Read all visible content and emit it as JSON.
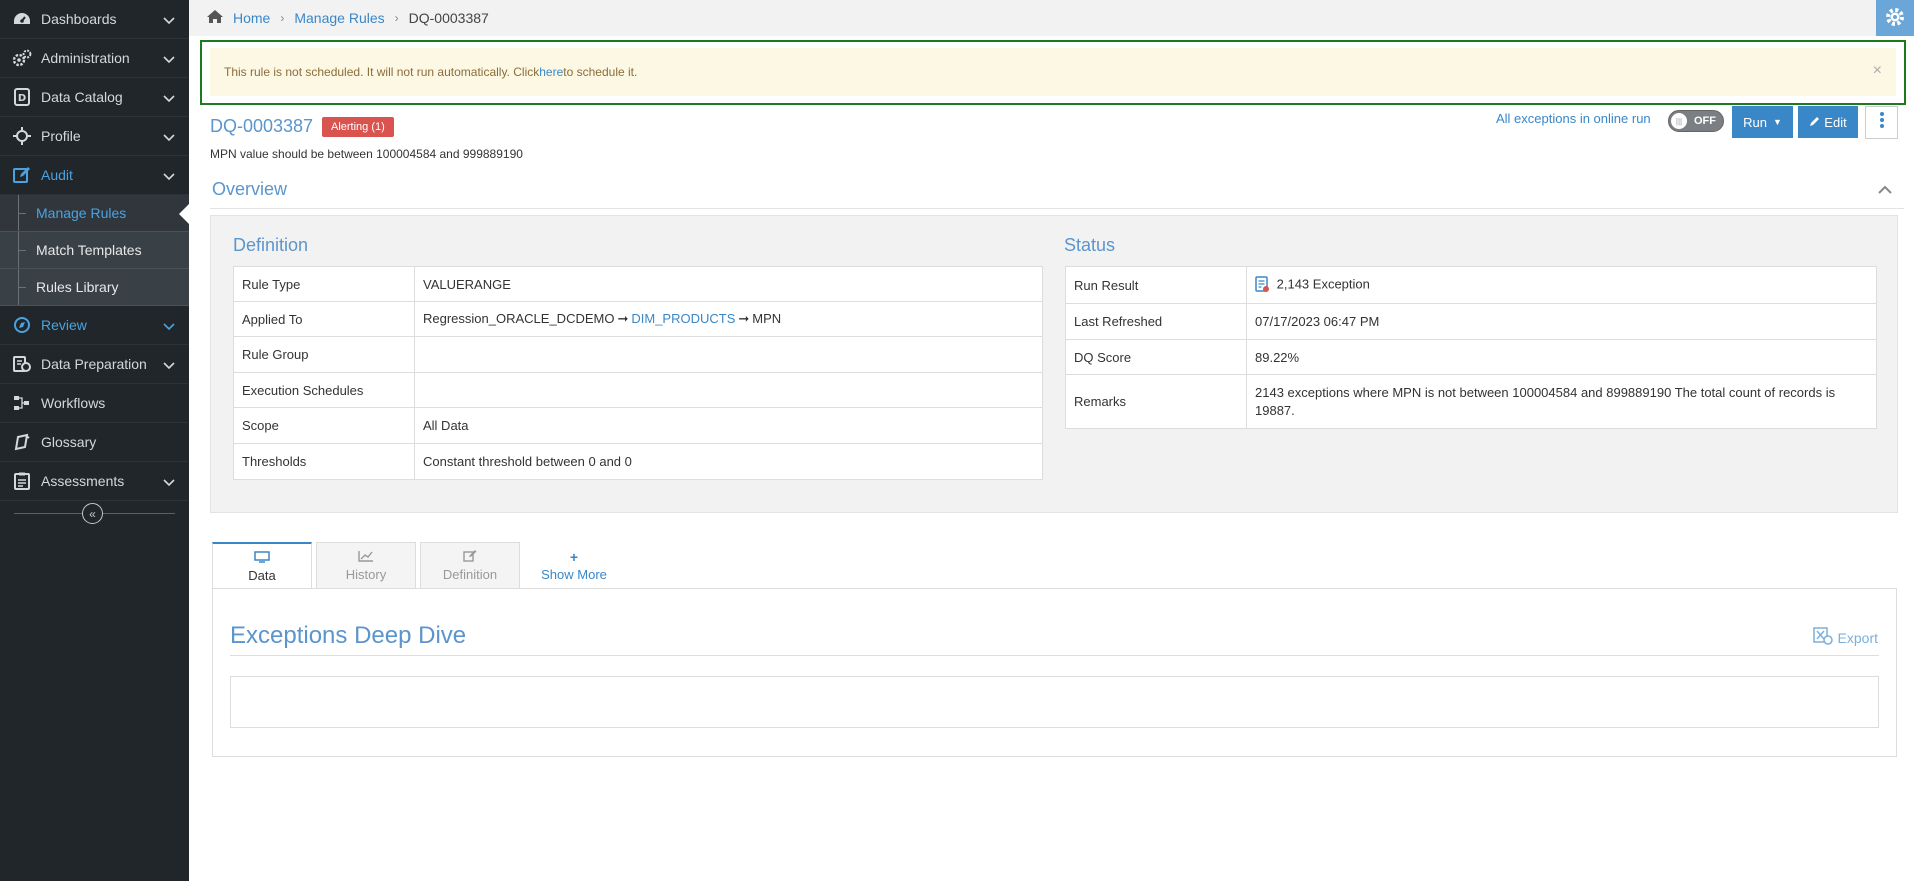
{
  "sidebar": {
    "items": [
      {
        "label": "Dashboards",
        "icon": "dashboard-icon"
      },
      {
        "label": "Administration",
        "icon": "gears-icon"
      },
      {
        "label": "Data Catalog",
        "icon": "catalog-icon"
      },
      {
        "label": "Profile",
        "icon": "crosshair-icon"
      },
      {
        "label": "Audit",
        "icon": "edit-icon"
      }
    ],
    "audit_sub": [
      {
        "label": "Manage Rules"
      },
      {
        "label": "Match Templates"
      },
      {
        "label": "Rules Library"
      }
    ],
    "items_after": [
      {
        "label": "Review",
        "icon": "compass-icon"
      },
      {
        "label": "Data Preparation",
        "icon": "data-prep-icon"
      },
      {
        "label": "Workflows",
        "icon": "workflow-icon"
      },
      {
        "label": "Glossary",
        "icon": "glossary-icon"
      },
      {
        "label": "Assessments",
        "icon": "clipboard-icon"
      }
    ]
  },
  "breadcrumb": {
    "home": "Home",
    "section": "Manage Rules",
    "current": "DQ-0003387"
  },
  "alert": {
    "text_before": "This rule is not scheduled. It will not run automatically. Click ",
    "link": "here",
    "text_after": " to schedule it."
  },
  "rule": {
    "id": "DQ-0003387",
    "badge": "Alerting (1)",
    "description": "MPN value should be between 100004584 and 999889190"
  },
  "toolbar": {
    "online_run_label": "All exceptions in online run",
    "toggle_state": "OFF",
    "run_label": "Run",
    "edit_label": "Edit"
  },
  "overview": {
    "title": "Overview"
  },
  "definition": {
    "title": "Definition",
    "rule_type_label": "Rule Type",
    "rule_type": "VALUERANGE",
    "applied_to_label": "Applied To",
    "applied_source": "Regression_ORACLE_DCDEMO",
    "applied_table": "DIM_PRODUCTS",
    "applied_column": "MPN",
    "arrow": "➞",
    "rule_group_label": "Rule Group",
    "rule_group": "",
    "schedules_label": "Execution Schedules",
    "schedules": "",
    "scope_label": "Scope",
    "scope": "All Data",
    "thresholds_label": "Thresholds",
    "thresholds": "Constant threshold between 0 and 0"
  },
  "status": {
    "title": "Status",
    "run_result_label": "Run Result",
    "run_result": "2,143 Exception",
    "last_refreshed_label": "Last Refreshed",
    "last_refreshed": "07/17/2023 06:47 PM",
    "dq_score_label": "DQ Score",
    "dq_score": "89.22%",
    "remarks_label": "Remarks",
    "remarks": "2143 exceptions where MPN is not between 100004584 and 899889190 The total count of records is 19887."
  },
  "tabs": [
    {
      "label": "Data"
    },
    {
      "label": "History"
    },
    {
      "label": "Definition"
    },
    {
      "label": "Show More"
    }
  ],
  "deep_dive": {
    "title": "Exceptions Deep Dive",
    "export_label": "Export"
  },
  "colors": {
    "accent": "#3a87c8",
    "danger": "#d9534f",
    "sidebar": "#21262a",
    "alert_border": "#1d7a1d"
  }
}
